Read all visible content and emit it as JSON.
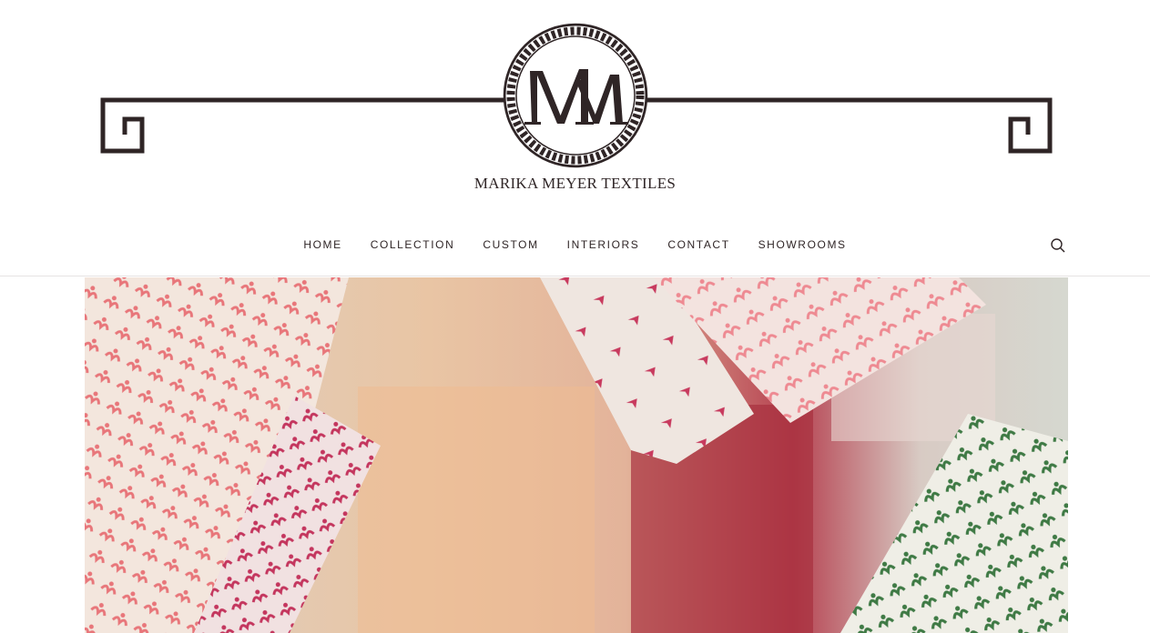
{
  "brand": {
    "name": "MARIKA MEYER TEXTILES",
    "monogram": "MM",
    "colors": {
      "brand_dark": "#2f2526"
    }
  },
  "nav": {
    "items": [
      "HOME",
      "COLLECTION",
      "CUSTOM",
      "INTERIORS",
      "CONTACT",
      "SHOWROOMS"
    ]
  },
  "search": {
    "icon": "search-icon"
  },
  "hero": {
    "alt": "fabric-swatches-on-painted-canvas"
  }
}
